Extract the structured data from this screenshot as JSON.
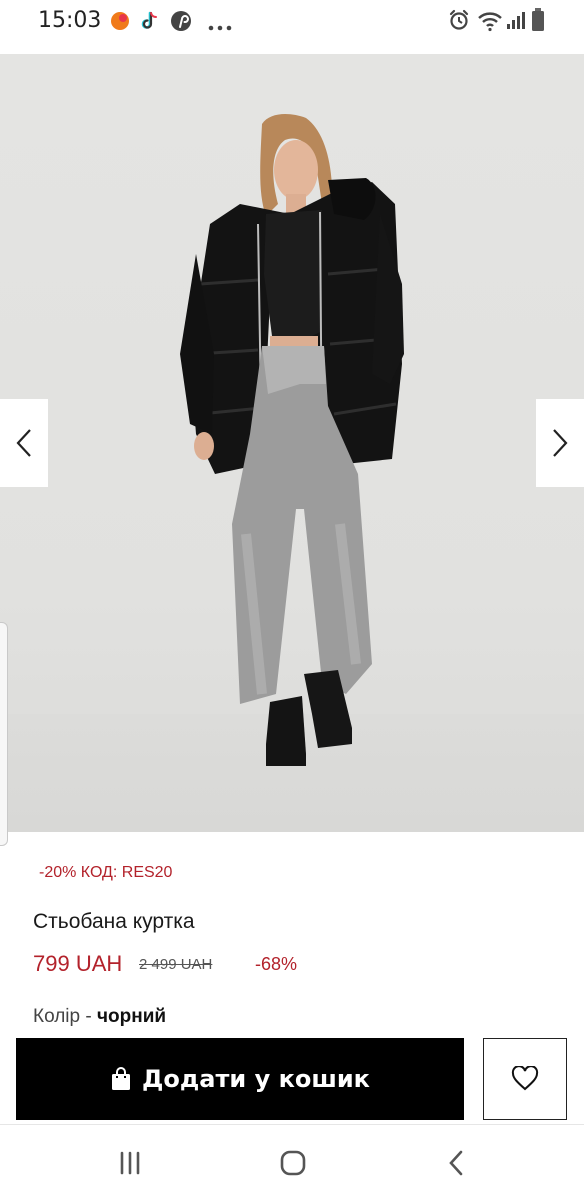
{
  "status_bar": {
    "time": "15:03",
    "left_icons": [
      "notification-app-icon",
      "tiktok-icon",
      "pinterest-icon",
      "more-dots-icon"
    ],
    "right_icons": [
      "alarm-icon",
      "wifi-icon",
      "signal-icon",
      "battery-icon"
    ]
  },
  "gallery": {
    "image_subject": "product-photo",
    "prev_icon": "chevron-left-icon",
    "next_icon": "chevron-right-icon"
  },
  "product": {
    "promo": "-20% КОД: RES20",
    "title": "Стьобана куртка",
    "price": "799 UAH",
    "old_price": "2 499 UAH",
    "discount": "-68%",
    "color_label": "Колір - ",
    "color_value": "чорний"
  },
  "actions": {
    "add_to_cart": "Додати у кошик",
    "cart_icon": "shopping-bag-icon",
    "wishlist_icon": "heart-icon"
  },
  "system_nav": [
    "recent-apps-icon",
    "home-icon",
    "back-icon"
  ],
  "colors": {
    "accent_red": "#b3222b",
    "button_black": "#000000"
  }
}
